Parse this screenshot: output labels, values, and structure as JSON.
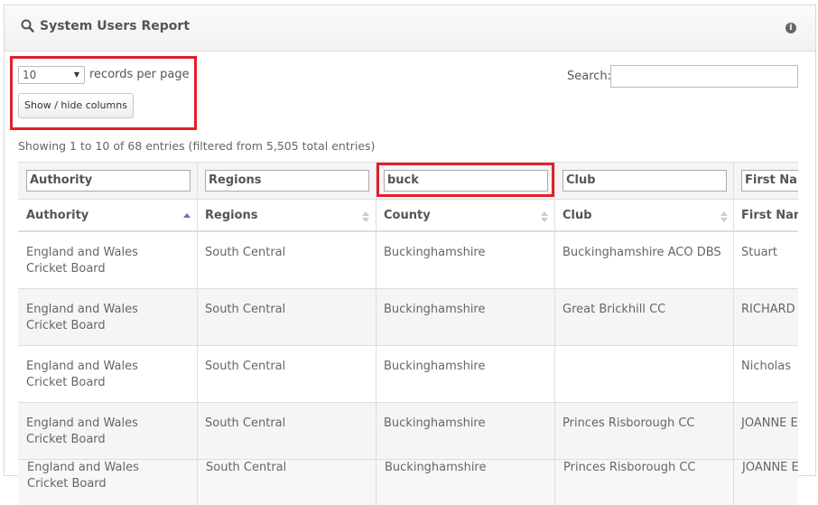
{
  "panel": {
    "title": "System Users Report",
    "search_icon": "search-icon",
    "info_icon": "info-icon"
  },
  "controls": {
    "page_size": "10",
    "page_size_suffix": "records per page",
    "columns_button": "Show / hide columns",
    "search_label": "Search:",
    "search_value": ""
  },
  "info_text": "Showing 1 to 10 of 68 entries (filtered from 5,505 total entries)",
  "filters": [
    "Authority",
    "Regions",
    "buck",
    "Club",
    "First Nam"
  ],
  "headers": [
    "Authority",
    "Regions",
    "County",
    "Club",
    "First Nam"
  ],
  "rows": [
    {
      "authority": "England and Wales Cricket Board",
      "region": "South Central",
      "county": "Buckinghamshire",
      "club": "Buckinghamshire ACO DBS",
      "first_name": "Stuart"
    },
    {
      "authority": "England and Wales Cricket Board",
      "region": "South Central",
      "county": "Buckinghamshire",
      "club": "Great Brickhill CC",
      "first_name": "RICHARD I..."
    },
    {
      "authority": "England and Wales Cricket Board",
      "region": "South Central",
      "county": "Buckinghamshire",
      "club": "",
      "first_name": "Nicholas"
    },
    {
      "authority": "England and Wales Cricket Board",
      "region": "South Central",
      "county": "Buckinghamshire",
      "club": "Princes Risborough CC",
      "first_name": "JOANNE EL"
    },
    {
      "authority": "England and Wales Cricket Board",
      "region": "South Central",
      "county": "Buckinghamshire",
      "club": "Princes Risborough CC",
      "first_name": "JOANNE EL"
    }
  ],
  "colors": {
    "highlight": "#e0202a",
    "sort_active": "#5b6fd6"
  }
}
